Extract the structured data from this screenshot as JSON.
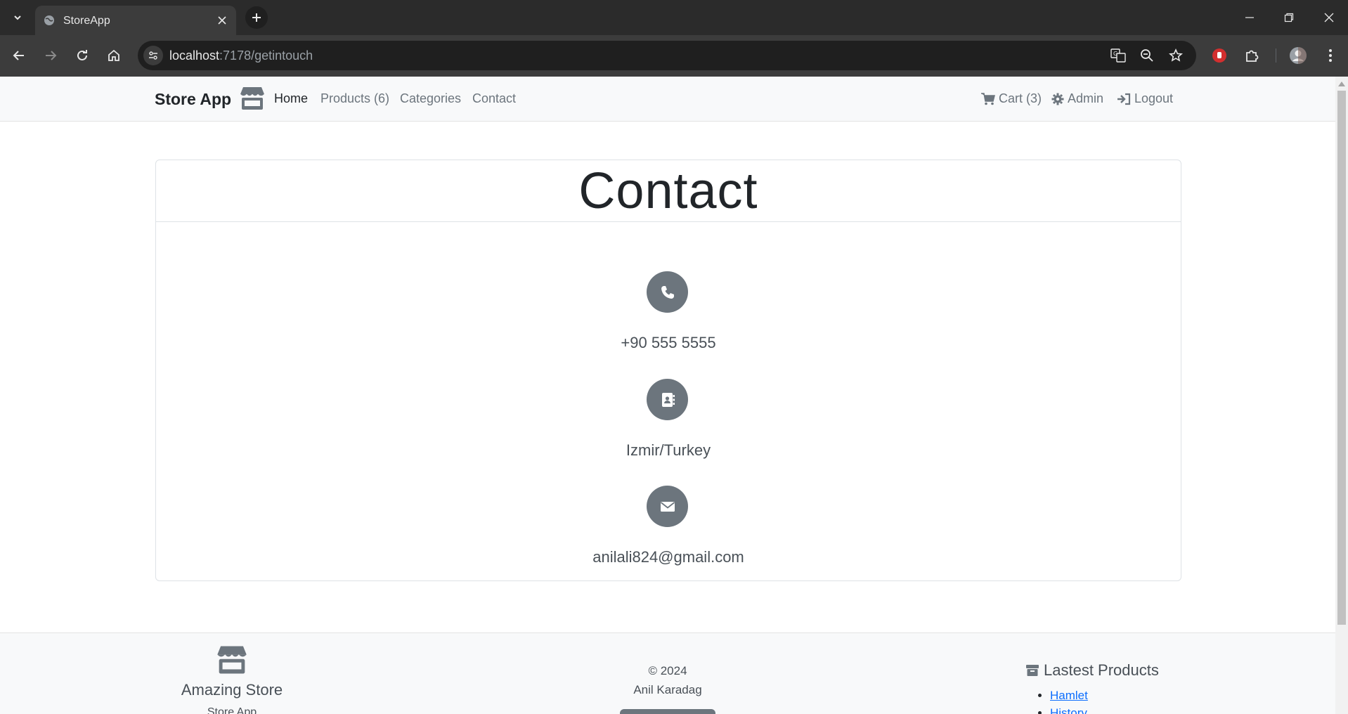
{
  "browser": {
    "tab_title": "StoreApp",
    "url_host": "localhost",
    "url_path": ":7178/getintouch"
  },
  "navbar": {
    "brand": "Store App",
    "links": [
      {
        "label": "Home",
        "active": true
      },
      {
        "label": "Products (6)",
        "active": false
      },
      {
        "label": "Categories",
        "active": false
      },
      {
        "label": "Contact",
        "active": false
      }
    ],
    "right": [
      {
        "label": "Cart (3)",
        "icon": "cart-icon"
      },
      {
        "label": "Admin",
        "icon": "gear-icon"
      },
      {
        "label": "Logout",
        "icon": "sign-out-icon"
      }
    ]
  },
  "contact": {
    "title": "Contact",
    "items": [
      {
        "icon": "phone-icon",
        "text": "+90 555 5555"
      },
      {
        "icon": "address-book-icon",
        "text": "Izmir/Turkey"
      },
      {
        "icon": "envelope-icon",
        "text": "anilali824@gmail.com"
      }
    ]
  },
  "footer": {
    "brand": "Amazing Store",
    "sub": "Store App",
    "copyright": "© 2024",
    "author": "Anil Karadag",
    "latest_title": "Lastest Products",
    "latest_products": [
      "Hamlet",
      "History"
    ]
  },
  "colors": {
    "accent_link": "#0d6efd",
    "icon_circle": "#6c757d",
    "chrome_dark": "#2b2b2b"
  }
}
